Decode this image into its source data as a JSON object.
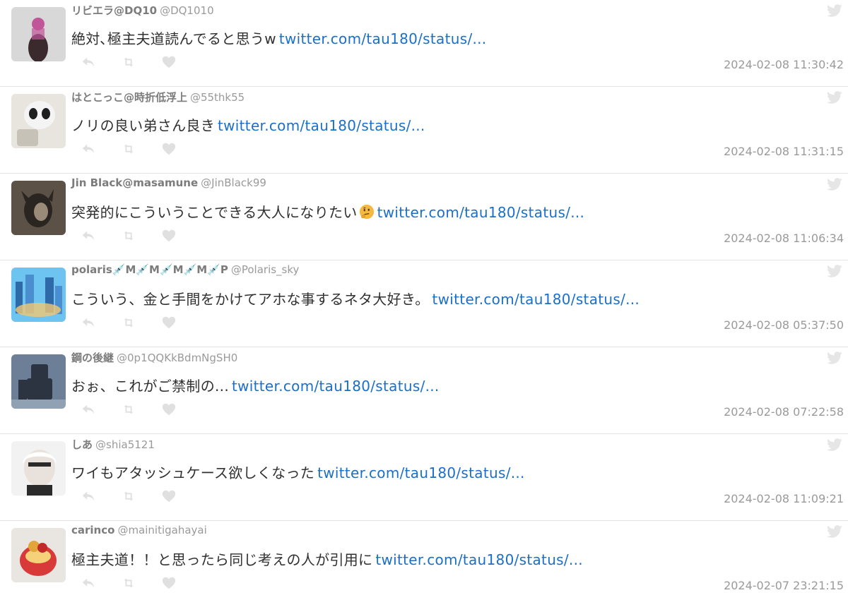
{
  "tweets": [
    {
      "name": "リビエラ@DQ10",
      "handle": "@DQ1010",
      "text": "絶対､極主夫道読んでると思うw",
      "link": "twitter.com/tau180/status/...",
      "time": "2024-02-08 11:30:42",
      "avatar_colors": [
        "#d8d8d8",
        "#3a2a2e",
        "#c0559a"
      ]
    },
    {
      "name": "はとこっこ@時折低浮上",
      "handle": "@55thk55",
      "text": "ノリの良い弟さん良き",
      "link": "twitter.com/tau180/status/...",
      "time": "2024-02-08 11:31:15",
      "avatar_colors": [
        "#e8e4de",
        "#1e1e1e",
        "#f4f4f4"
      ]
    },
    {
      "name": "Jin Black@masamune",
      "handle": "@JinBlack99",
      "text": "突発的にこういうことできる大人になりたい",
      "emoji": "thinking-face-emoji",
      "link": "twitter.com/tau180/status/...",
      "time": "2024-02-08 11:06:34",
      "avatar_colors": [
        "#5b5147",
        "#2b2521",
        "#9a8a78"
      ]
    },
    {
      "name": "polaris💉M💉M💉M💉M💉P",
      "handle": "@Polaris_sky",
      "text": "こういう、金と手間をかけてアホな事するネタ大好き。",
      "link": "twitter.com/tau180/status/...",
      "time": "2024-02-08 05:37:50",
      "avatar_colors": [
        "#6ec4f0",
        "#2f6aa8",
        "#f2c873"
      ]
    },
    {
      "name": "鋼の後継",
      "handle": "@0p1QQKkBdmNgSH0",
      "text": "おぉ、これがご禁制の...",
      "link": "twitter.com/tau180/status/...",
      "time": "2024-02-08 07:22:58",
      "avatar_colors": [
        "#6c7f96",
        "#2b3440",
        "#a9b7c6"
      ]
    },
    {
      "name": "しあ",
      "handle": "@shia5121",
      "text": "ワイもアタッシュケース欲しくなった",
      "link": "twitter.com/tau180/status/...",
      "time": "2024-02-08 11:09:21",
      "avatar_colors": [
        "#f2f2f2",
        "#2a2a2a",
        "#e9e2dc"
      ]
    },
    {
      "name": "carinco",
      "handle": "@mainitigahayai",
      "text": "極主夫道！！と思ったら同じ考えの人が引用に",
      "link": "twitter.com/tau180/status/...",
      "time": "2024-02-07 23:21:15",
      "avatar_colors": [
        "#e9e5e0",
        "#e3a43a",
        "#d83a3a"
      ]
    }
  ],
  "icons": {
    "reply": "reply-icon",
    "retweet": "retweet-icon",
    "like": "heart-icon",
    "brand": "twitter-bird-icon"
  },
  "colors": {
    "link": "#1a6fc8",
    "icon": "#e0e0e0",
    "meta": "#8a8a8a"
  }
}
